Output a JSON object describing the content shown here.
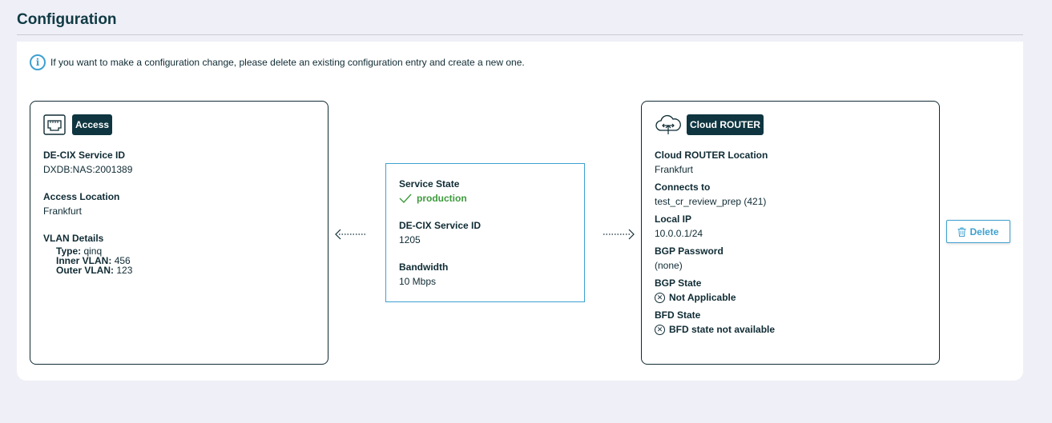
{
  "page": {
    "title": "Configuration"
  },
  "info": {
    "message": "If you want to make a configuration change, please delete an existing configuration entry and create a new one."
  },
  "access": {
    "badge": "Access",
    "service_id_label": "DE-CIX Service ID",
    "service_id": "DXDB:NAS:2001389",
    "location_label": "Access Location",
    "location": "Frankfurt",
    "vlan_label": "VLAN Details",
    "vlan": {
      "type_label": "Type:",
      "type": "qinq",
      "inner_label": "Inner VLAN:",
      "inner": "456",
      "outer_label": "Outer VLAN:",
      "outer": "123"
    }
  },
  "service": {
    "state_label": "Service State",
    "state": "production",
    "service_id_label": "DE-CIX Service ID",
    "service_id": "1205",
    "bandwidth_label": "Bandwidth",
    "bandwidth": "10 Mbps"
  },
  "router": {
    "badge": "Cloud ROUTER",
    "location_label": "Cloud ROUTER Location",
    "location": "Frankfurt",
    "connects_label": "Connects to",
    "connects": "test_cr_review_prep (421)",
    "local_ip_label": "Local IP",
    "local_ip": "10.0.0.1/24",
    "bgp_password_label": "BGP Password",
    "bgp_password": "(none)",
    "bgp_state_label": "BGP State",
    "bgp_state": "Not Applicable",
    "bfd_state_label": "BFD State",
    "bfd_state": "BFD state not available"
  },
  "actions": {
    "delete_label": "Delete"
  },
  "icons": {
    "info": "info-icon",
    "access": "ethernet-port-icon",
    "router": "cloud-icon",
    "check": "check-icon",
    "x": "x-circle-icon",
    "trash": "trash-icon"
  },
  "colors": {
    "accent": "#3ea0d0",
    "dark": "#0f3540",
    "success": "#3d9b3d",
    "background": "#efeff7"
  }
}
